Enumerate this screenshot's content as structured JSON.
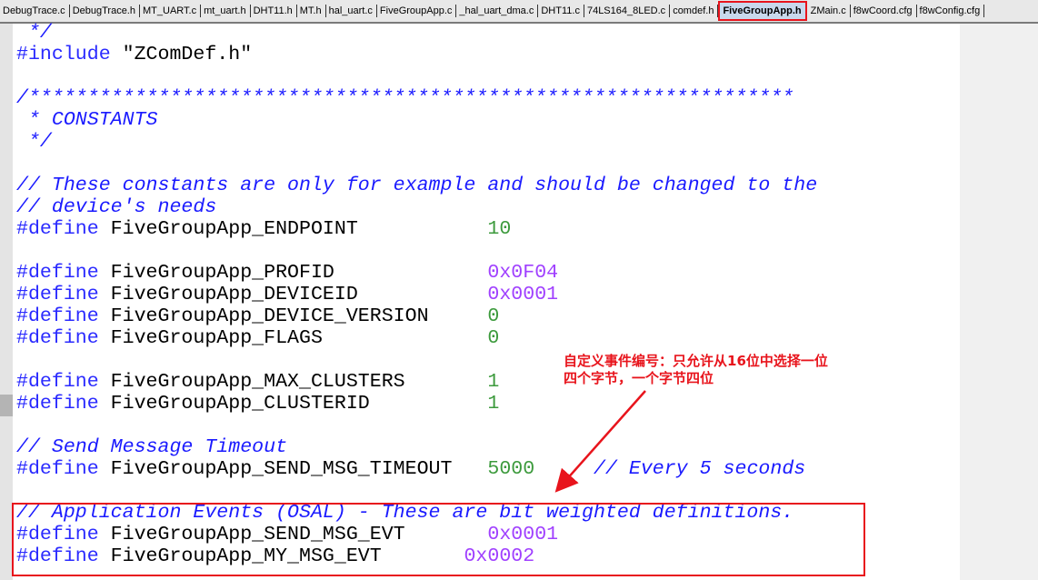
{
  "tabs": [
    "DebugTrace.c",
    "DebugTrace.h",
    "MT_UART.c",
    "mt_uart.h",
    "DHT11.h",
    "MT.h",
    "hal_uart.c",
    "FiveGroupApp.c",
    "_hal_uart_dma.c",
    "DHT11.c",
    "74LS164_8LED.c",
    "comdef.h",
    "FiveGroupApp.h",
    "ZMain.c",
    "f8wCoord.cfg",
    "f8wConfig.cfg"
  ],
  "active_tab": "FiveGroupApp.h",
  "code": [
    {
      "t": "c",
      "text": " */"
    },
    {
      "pp": "#include",
      "rest": " \"ZComDef.h\""
    },
    {
      "t": "blank",
      "text": ""
    },
    {
      "t": "c",
      "text": "/*****************************************************************"
    },
    {
      "t": "c",
      "text": " * CONSTANTS"
    },
    {
      "t": "c",
      "text": " */"
    },
    {
      "t": "blank",
      "text": ""
    },
    {
      "t": "c",
      "text": "// These constants are only for example and should be changed to the"
    },
    {
      "t": "c",
      "text": "// device's needs"
    },
    {
      "pp": "#define",
      "rest": " FiveGroupApp_ENDPOINT           ",
      "val": "10",
      "vt": "n"
    },
    {
      "t": "blank",
      "text": ""
    },
    {
      "pp": "#define",
      "rest": " FiveGroupApp_PROFID             ",
      "val": "0x0F04",
      "vt": "h"
    },
    {
      "pp": "#define",
      "rest": " FiveGroupApp_DEVICEID           ",
      "val": "0x0001",
      "vt": "h"
    },
    {
      "pp": "#define",
      "rest": " FiveGroupApp_DEVICE_VERSION     ",
      "val": "0",
      "vt": "n"
    },
    {
      "pp": "#define",
      "rest": " FiveGroupApp_FLAGS              ",
      "val": "0",
      "vt": "n"
    },
    {
      "t": "blank",
      "text": ""
    },
    {
      "pp": "#define",
      "rest": " FiveGroupApp_MAX_CLUSTERS       ",
      "val": "1",
      "vt": "n"
    },
    {
      "pp": "#define",
      "rest": " FiveGroupApp_CLUSTERID          ",
      "val": "1",
      "vt": "n"
    },
    {
      "t": "blank",
      "text": ""
    },
    {
      "t": "c",
      "text": "// Send Message Timeout"
    },
    {
      "pp": "#define",
      "rest": " FiveGroupApp_SEND_MSG_TIMEOUT   ",
      "val": "5000",
      "vt": "n",
      "tail": "     // Every 5 seconds"
    },
    {
      "t": "blank",
      "text": ""
    },
    {
      "t": "c",
      "text": "// Application Events (OSAL) - These are bit weighted definitions."
    },
    {
      "pp": "#define",
      "rest": " FiveGroupApp_SEND_MSG_EVT       ",
      "val": "0x0001",
      "vt": "h"
    },
    {
      "pp": "#define",
      "rest": " FiveGroupApp_MY_MSG_EVT       ",
      "val": "0x0002",
      "vt": "h"
    }
  ],
  "annotation": {
    "line1": "自定义事件编号：只允许从16位中选择一位",
    "line2": "四个字节，一个字节四位"
  },
  "colors": {
    "highlight": "#e8141c",
    "preprocessor": "#2a2aff",
    "comment": "#1a1aff",
    "number": "#3c9a3c",
    "hex": "#a040ff"
  }
}
